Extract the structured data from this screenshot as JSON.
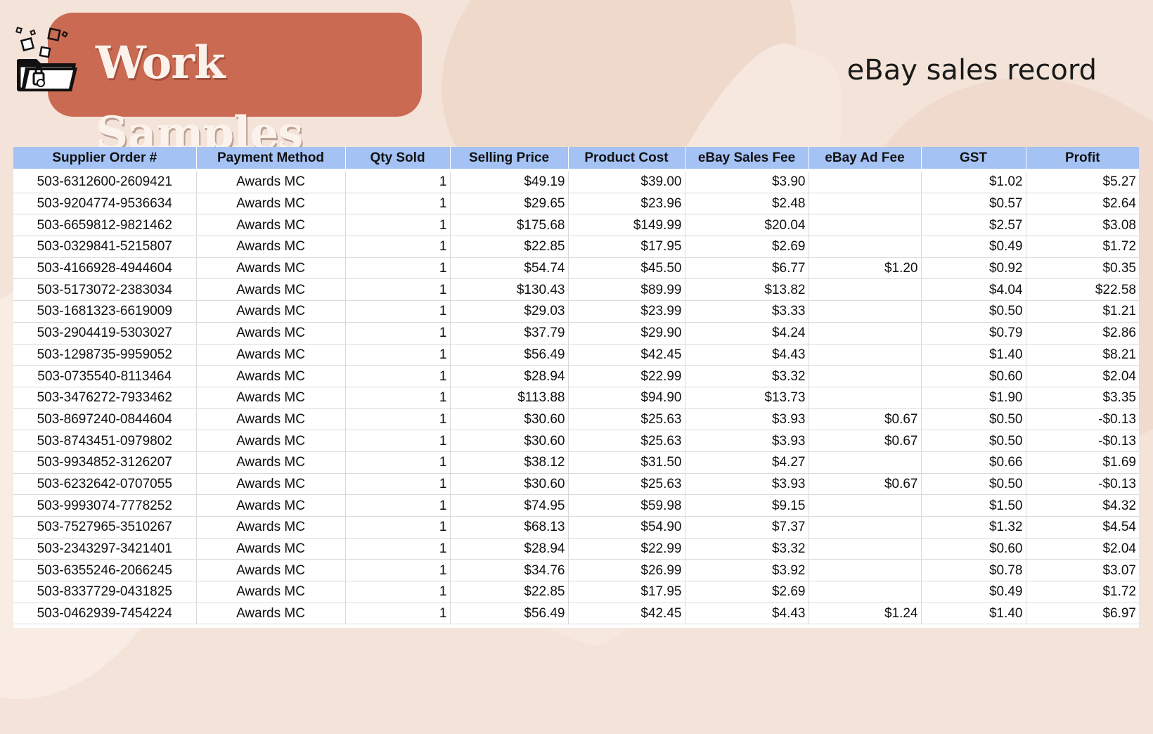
{
  "header": {
    "badge_title": "Work Samples",
    "subtitle": "eBay sales record",
    "badge_color": "#cb6a52",
    "header_row_color": "#a4c2f4"
  },
  "table": {
    "columns": [
      "Supplier Order #",
      "Payment Method",
      "Qty Sold",
      "Selling Price",
      "Product Cost",
      "eBay Sales Fee",
      "eBay Ad Fee",
      "GST",
      "Profit"
    ],
    "rows": [
      [
        "503-6312600-2609421",
        "Awards MC",
        "1",
        "$49.19",
        "$39.00",
        "$3.90",
        "",
        "$1.02",
        "$5.27"
      ],
      [
        "503-9204774-9536634",
        "Awards MC",
        "1",
        "$29.65",
        "$23.96",
        "$2.48",
        "",
        "$0.57",
        "$2.64"
      ],
      [
        "503-6659812-9821462",
        "Awards MC",
        "1",
        "$175.68",
        "$149.99",
        "$20.04",
        "",
        "$2.57",
        "$3.08"
      ],
      [
        "503-0329841-5215807",
        "Awards MC",
        "1",
        "$22.85",
        "$17.95",
        "$2.69",
        "",
        "$0.49",
        "$1.72"
      ],
      [
        "503-4166928-4944604",
        "Awards MC",
        "1",
        "$54.74",
        "$45.50",
        "$6.77",
        "$1.20",
        "$0.92",
        "$0.35"
      ],
      [
        "503-5173072-2383034",
        "Awards MC",
        "1",
        "$130.43",
        "$89.99",
        "$13.82",
        "",
        "$4.04",
        "$22.58"
      ],
      [
        "503-1681323-6619009",
        "Awards MC",
        "1",
        "$29.03",
        "$23.99",
        "$3.33",
        "",
        "$0.50",
        "$1.21"
      ],
      [
        "503-2904419-5303027",
        "Awards MC",
        "1",
        "$37.79",
        "$29.90",
        "$4.24",
        "",
        "$0.79",
        "$2.86"
      ],
      [
        "503-1298735-9959052",
        "Awards MC",
        "1",
        "$56.49",
        "$42.45",
        "$4.43",
        "",
        "$1.40",
        "$8.21"
      ],
      [
        "503-0735540-8113464",
        "Awards MC",
        "1",
        "$28.94",
        "$22.99",
        "$3.32",
        "",
        "$0.60",
        "$2.04"
      ],
      [
        "503-3476272-7933462",
        "Awards MC",
        "1",
        "$113.88",
        "$94.90",
        "$13.73",
        "",
        "$1.90",
        "$3.35"
      ],
      [
        "503-8697240-0844604",
        "Awards MC",
        "1",
        "$30.60",
        "$25.63",
        "$3.93",
        "$0.67",
        "$0.50",
        "-$0.13"
      ],
      [
        "503-8743451-0979802",
        "Awards MC",
        "1",
        "$30.60",
        "$25.63",
        "$3.93",
        "$0.67",
        "$0.50",
        "-$0.13"
      ],
      [
        "503-9934852-3126207",
        "Awards MC",
        "1",
        "$38.12",
        "$31.50",
        "$4.27",
        "",
        "$0.66",
        "$1.69"
      ],
      [
        "503-6232642-0707055",
        "Awards MC",
        "1",
        "$30.60",
        "$25.63",
        "$3.93",
        "$0.67",
        "$0.50",
        "-$0.13"
      ],
      [
        "503-9993074-7778252",
        "Awards MC",
        "1",
        "$74.95",
        "$59.98",
        "$9.15",
        "",
        "$1.50",
        "$4.32"
      ],
      [
        "503-7527965-3510267",
        "Awards MC",
        "1",
        "$68.13",
        "$54.90",
        "$7.37",
        "",
        "$1.32",
        "$4.54"
      ],
      [
        "503-2343297-3421401",
        "Awards MC",
        "1",
        "$28.94",
        "$22.99",
        "$3.32",
        "",
        "$0.60",
        "$2.04"
      ],
      [
        "503-6355246-2066245",
        "Awards MC",
        "1",
        "$34.76",
        "$26.99",
        "$3.92",
        "",
        "$0.78",
        "$3.07"
      ],
      [
        "503-8337729-0431825",
        "Awards MC",
        "1",
        "$22.85",
        "$17.95",
        "$2.69",
        "",
        "$0.49",
        "$1.72"
      ],
      [
        "503-0462939-7454224",
        "Awards MC",
        "1",
        "$56.49",
        "$42.45",
        "$4.43",
        "$1.24",
        "$1.40",
        "$6.97"
      ]
    ]
  }
}
